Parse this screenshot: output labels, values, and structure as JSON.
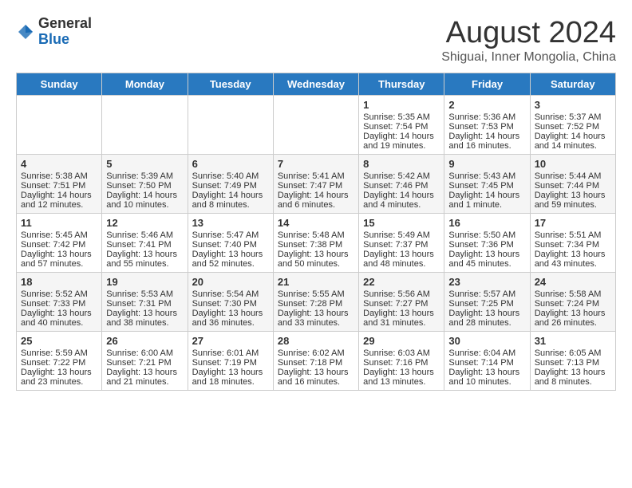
{
  "logo": {
    "general": "General",
    "blue": "Blue"
  },
  "header": {
    "title": "August 2024",
    "subtitle": "Shiguai, Inner Mongolia, China"
  },
  "calendar": {
    "headers": [
      "Sunday",
      "Monday",
      "Tuesday",
      "Wednesday",
      "Thursday",
      "Friday",
      "Saturday"
    ],
    "rows": [
      [
        {
          "day": "",
          "info": ""
        },
        {
          "day": "",
          "info": ""
        },
        {
          "day": "",
          "info": ""
        },
        {
          "day": "",
          "info": ""
        },
        {
          "day": "1",
          "info": "Sunrise: 5:35 AM\nSunset: 7:54 PM\nDaylight: 14 hours and 19 minutes."
        },
        {
          "day": "2",
          "info": "Sunrise: 5:36 AM\nSunset: 7:53 PM\nDaylight: 14 hours and 16 minutes."
        },
        {
          "day": "3",
          "info": "Sunrise: 5:37 AM\nSunset: 7:52 PM\nDaylight: 14 hours and 14 minutes."
        }
      ],
      [
        {
          "day": "4",
          "info": "Sunrise: 5:38 AM\nSunset: 7:51 PM\nDaylight: 14 hours and 12 minutes."
        },
        {
          "day": "5",
          "info": "Sunrise: 5:39 AM\nSunset: 7:50 PM\nDaylight: 14 hours and 10 minutes."
        },
        {
          "day": "6",
          "info": "Sunrise: 5:40 AM\nSunset: 7:49 PM\nDaylight: 14 hours and 8 minutes."
        },
        {
          "day": "7",
          "info": "Sunrise: 5:41 AM\nSunset: 7:47 PM\nDaylight: 14 hours and 6 minutes."
        },
        {
          "day": "8",
          "info": "Sunrise: 5:42 AM\nSunset: 7:46 PM\nDaylight: 14 hours and 4 minutes."
        },
        {
          "day": "9",
          "info": "Sunrise: 5:43 AM\nSunset: 7:45 PM\nDaylight: 14 hours and 1 minute."
        },
        {
          "day": "10",
          "info": "Sunrise: 5:44 AM\nSunset: 7:44 PM\nDaylight: 13 hours and 59 minutes."
        }
      ],
      [
        {
          "day": "11",
          "info": "Sunrise: 5:45 AM\nSunset: 7:42 PM\nDaylight: 13 hours and 57 minutes."
        },
        {
          "day": "12",
          "info": "Sunrise: 5:46 AM\nSunset: 7:41 PM\nDaylight: 13 hours and 55 minutes."
        },
        {
          "day": "13",
          "info": "Sunrise: 5:47 AM\nSunset: 7:40 PM\nDaylight: 13 hours and 52 minutes."
        },
        {
          "day": "14",
          "info": "Sunrise: 5:48 AM\nSunset: 7:38 PM\nDaylight: 13 hours and 50 minutes."
        },
        {
          "day": "15",
          "info": "Sunrise: 5:49 AM\nSunset: 7:37 PM\nDaylight: 13 hours and 48 minutes."
        },
        {
          "day": "16",
          "info": "Sunrise: 5:50 AM\nSunset: 7:36 PM\nDaylight: 13 hours and 45 minutes."
        },
        {
          "day": "17",
          "info": "Sunrise: 5:51 AM\nSunset: 7:34 PM\nDaylight: 13 hours and 43 minutes."
        }
      ],
      [
        {
          "day": "18",
          "info": "Sunrise: 5:52 AM\nSunset: 7:33 PM\nDaylight: 13 hours and 40 minutes."
        },
        {
          "day": "19",
          "info": "Sunrise: 5:53 AM\nSunset: 7:31 PM\nDaylight: 13 hours and 38 minutes."
        },
        {
          "day": "20",
          "info": "Sunrise: 5:54 AM\nSunset: 7:30 PM\nDaylight: 13 hours and 36 minutes."
        },
        {
          "day": "21",
          "info": "Sunrise: 5:55 AM\nSunset: 7:28 PM\nDaylight: 13 hours and 33 minutes."
        },
        {
          "day": "22",
          "info": "Sunrise: 5:56 AM\nSunset: 7:27 PM\nDaylight: 13 hours and 31 minutes."
        },
        {
          "day": "23",
          "info": "Sunrise: 5:57 AM\nSunset: 7:25 PM\nDaylight: 13 hours and 28 minutes."
        },
        {
          "day": "24",
          "info": "Sunrise: 5:58 AM\nSunset: 7:24 PM\nDaylight: 13 hours and 26 minutes."
        }
      ],
      [
        {
          "day": "25",
          "info": "Sunrise: 5:59 AM\nSunset: 7:22 PM\nDaylight: 13 hours and 23 minutes."
        },
        {
          "day": "26",
          "info": "Sunrise: 6:00 AM\nSunset: 7:21 PM\nDaylight: 13 hours and 21 minutes."
        },
        {
          "day": "27",
          "info": "Sunrise: 6:01 AM\nSunset: 7:19 PM\nDaylight: 13 hours and 18 minutes."
        },
        {
          "day": "28",
          "info": "Sunrise: 6:02 AM\nSunset: 7:18 PM\nDaylight: 13 hours and 16 minutes."
        },
        {
          "day": "29",
          "info": "Sunrise: 6:03 AM\nSunset: 7:16 PM\nDaylight: 13 hours and 13 minutes."
        },
        {
          "day": "30",
          "info": "Sunrise: 6:04 AM\nSunset: 7:14 PM\nDaylight: 13 hours and 10 minutes."
        },
        {
          "day": "31",
          "info": "Sunrise: 6:05 AM\nSunset: 7:13 PM\nDaylight: 13 hours and 8 minutes."
        }
      ]
    ]
  }
}
